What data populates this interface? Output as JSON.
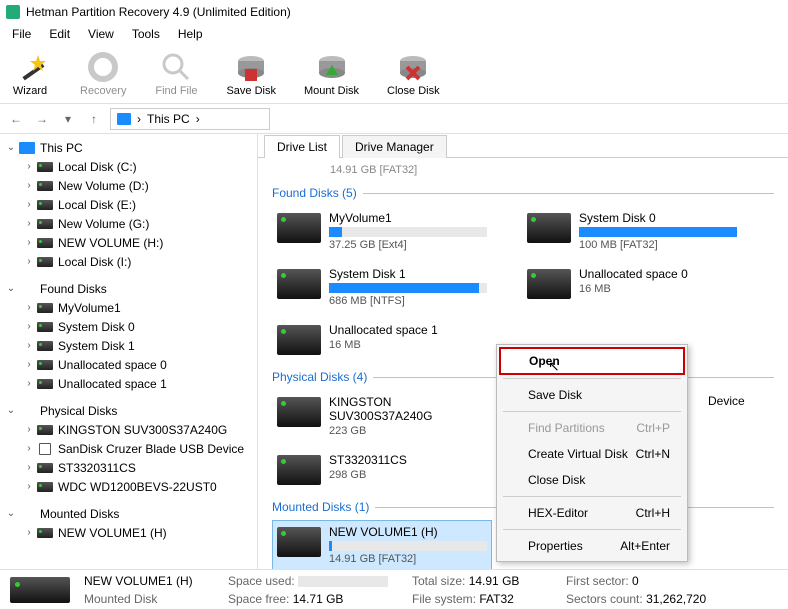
{
  "window": {
    "title": "Hetman Partition Recovery 4.9 (Unlimited Edition)"
  },
  "menus": {
    "file": "File",
    "edit": "Edit",
    "view": "View",
    "tools": "Tools",
    "help": "Help"
  },
  "toolbar": {
    "wizard": "Wizard",
    "recovery": "Recovery",
    "findfile": "Find File",
    "savedisk": "Save Disk",
    "mountdisk": "Mount Disk",
    "closedisk": "Close Disk"
  },
  "nav": {
    "thispc": "This PC",
    "sep": "›"
  },
  "tree": {
    "thispc": "This PC",
    "localc": "Local Disk (C:)",
    "newvold": "New Volume (D:)",
    "locale": "Local Disk (E:)",
    "newvolg": "New Volume (G:)",
    "newvolh": "NEW VOLUME (H:)",
    "locali": "Local Disk (I:)",
    "found_hdr": "Found Disks",
    "myvol1": "MyVolume1",
    "sysd0": "System Disk 0",
    "sysd1": "System Disk 1",
    "unalloc0": "Unallocated space 0",
    "unalloc1": "Unallocated space 1",
    "phys_hdr": "Physical Disks",
    "kingston": "KINGSTON SUV300S37A240G",
    "sandisk": "SanDisk Cruzer Blade USB Device",
    "st33": "ST3320311CS",
    "wdc": "WDC WD1200BEVS-22UST0",
    "mounted_hdr": "Mounted Disks",
    "mountedh": "NEW VOLUME1 (H)"
  },
  "tabs": {
    "drivelist": "Drive List",
    "drivemgr": "Drive Manager"
  },
  "truncated": "14.91 GB [FAT32]",
  "sections": {
    "found": "Found Disks (5)",
    "phys": "Physical Disks (4)",
    "mounted": "Mounted Disks (1)"
  },
  "disks": {
    "myvol1": {
      "name": "MyVolume1",
      "det": "37.25 GB [Ext4]",
      "fill": 8
    },
    "sysd0": {
      "name": "System Disk 0",
      "det": "100 MB [FAT32]",
      "fill": 100
    },
    "sysd1": {
      "name": "System Disk 1",
      "det": "686 MB [NTFS]",
      "fill": 95
    },
    "unalloc0": {
      "name": "Unallocated space 0",
      "det": "16 MB",
      "fill": -1
    },
    "unalloc1": {
      "name": "Unallocated space 1",
      "det": "16 MB",
      "fill": -1
    },
    "kingston": {
      "name": "KINGSTON SUV300S37A240G",
      "det": "223 GB",
      "fill": -1
    },
    "st33": {
      "name": "ST3320311CS",
      "det": "298 GB",
      "fill": -1
    },
    "device_frag": "Device",
    "mountedh": {
      "name": "NEW VOLUME1 (H)",
      "det": "14.91 GB [FAT32]",
      "fill": 2
    }
  },
  "ctx": {
    "open": "Open",
    "save": "Save Disk",
    "findp": "Find Partitions",
    "findp_k": "Ctrl+P",
    "createv": "Create Virtual Disk",
    "createv_k": "Ctrl+N",
    "close": "Close Disk",
    "hex": "HEX-Editor",
    "hex_k": "Ctrl+H",
    "props": "Properties",
    "props_k": "Alt+Enter"
  },
  "footer": {
    "name": "NEW VOLUME1 (H)",
    "sub": "Mounted Disk",
    "used_l": "Space used:",
    "free_l": "Space free:",
    "free_v": "14.71 GB",
    "total_l": "Total size:",
    "total_v": "14.91 GB",
    "fs_l": "File system:",
    "fs_v": "FAT32",
    "first_l": "First sector:",
    "first_v": "0",
    "count_l": "Sectors count:",
    "count_v": "31,262,720"
  }
}
